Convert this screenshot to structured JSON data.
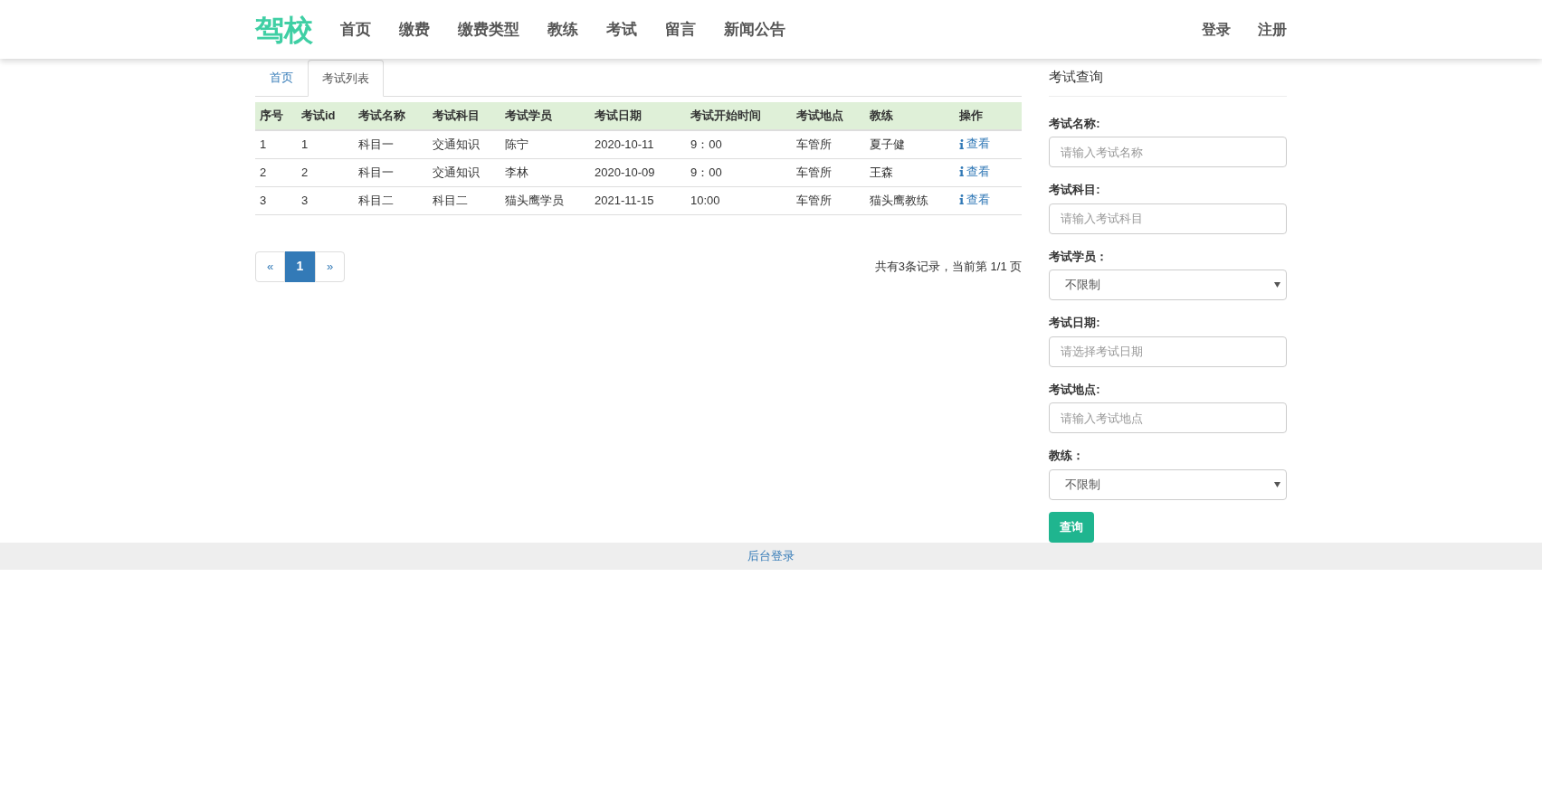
{
  "navbar": {
    "brand": "驾校",
    "links": [
      "首页",
      "缴费",
      "缴费类型",
      "教练",
      "考试",
      "留言",
      "新闻公告"
    ],
    "auth_links": [
      "登录",
      "注册"
    ]
  },
  "tabs": [
    {
      "label": "首页",
      "selected": false
    },
    {
      "label": "考试列表",
      "selected": true
    }
  ],
  "table": {
    "columns": [
      "序号",
      "考试id",
      "考试名称",
      "考试科目",
      "考试学员",
      "考试日期",
      "考试开始时间",
      "考试地点",
      "教练",
      "操作"
    ],
    "rows": [
      [
        "1",
        "1",
        "科目一",
        "交通知识",
        "陈宁",
        "2020-10-11",
        "9：00",
        "车管所",
        "夏子健",
        "查看"
      ],
      [
        "2",
        "2",
        "科目一",
        "交通知识",
        "李林",
        "2020-10-09",
        "9：00",
        "车管所",
        "王森",
        "查看"
      ],
      [
        "3",
        "3",
        "科目二",
        "科目二",
        "猫头鹰学员",
        "2021-11-15",
        "10:00",
        "车管所",
        "猫头鹰教练",
        "查看"
      ]
    ]
  },
  "pagination": {
    "pages": [
      {
        "label": "«",
        "selected": false
      },
      {
        "label": "1",
        "selected": true
      },
      {
        "label": "»",
        "selected": false
      }
    ],
    "summary": "共有3条记录，当前第 1/1 页"
  },
  "search_panel": {
    "title": "考试查询",
    "fields": [
      {
        "kind": "input",
        "label": "考试名称:",
        "placeholder": "请输入考试名称"
      },
      {
        "kind": "input",
        "label": "考试科目:",
        "placeholder": "请输入考试科目"
      },
      {
        "kind": "select",
        "label": "考试学员：",
        "value": "不限制"
      },
      {
        "kind": "input",
        "label": "考试日期:",
        "placeholder": "请选择考试日期"
      },
      {
        "kind": "input",
        "label": "考试地点:",
        "placeholder": "请输入考试地点"
      },
      {
        "kind": "select",
        "label": "教练：",
        "value": "不限制"
      }
    ],
    "button": "查询"
  },
  "footer": {
    "link": "后台登录"
  }
}
